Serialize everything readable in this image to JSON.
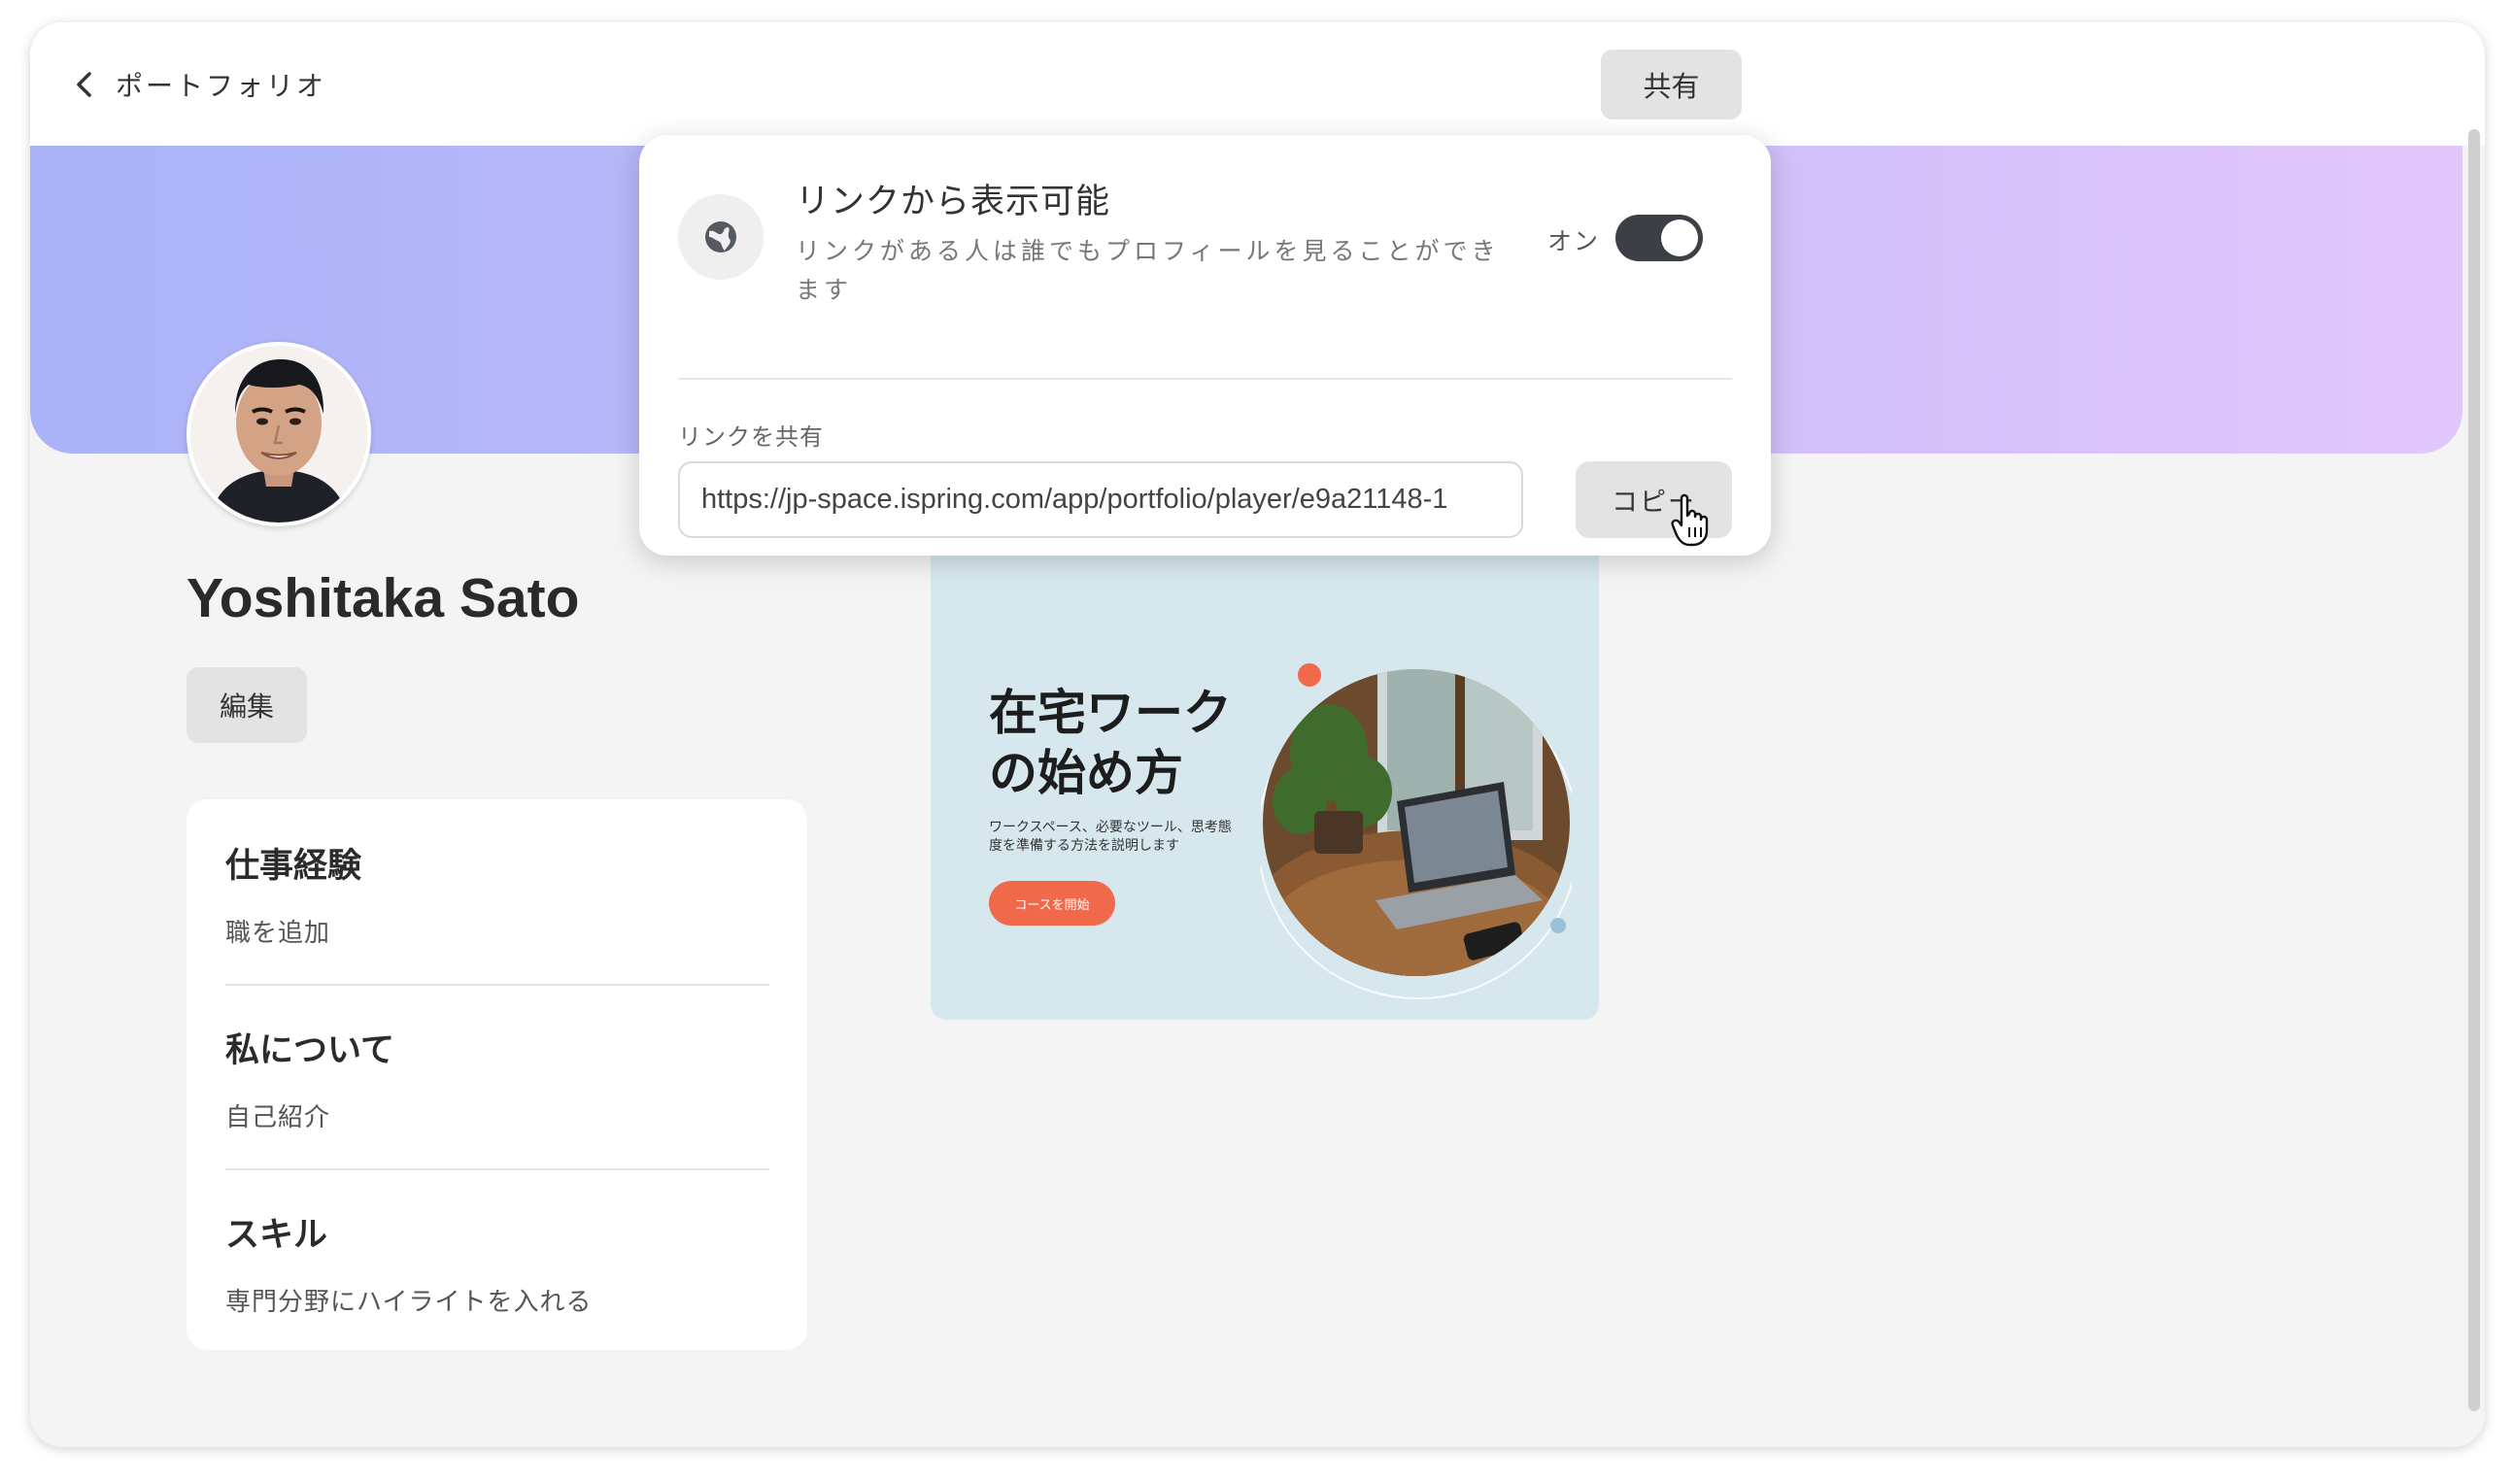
{
  "header": {
    "title": "ポートフォリオ",
    "share_label": "共有"
  },
  "profile": {
    "name": "Yoshitaka Sato",
    "edit_label": "編集"
  },
  "info_sections": [
    {
      "heading": "仕事経験",
      "subtext": "職を追加"
    },
    {
      "heading": "私について",
      "subtext": "自己紹介"
    },
    {
      "heading": "スキル",
      "subtext": "専門分野にハイライトを入れる"
    }
  ],
  "course": {
    "title": "在宅ワークの始め方",
    "description": "ワークスペース、必要なツール、思考態度を準備する方法を説明します",
    "button_label": "コースを開始"
  },
  "share_popup": {
    "title": "リンクから表示可能",
    "description": "リンクがある人は誰でもプロフィールを見ることができます",
    "toggle_label": "オン",
    "toggle_on": true,
    "link_label": "リンクを共有",
    "link_value": "https://jp-space.ispring.com/app/portfolio/player/e9a21148-1",
    "copy_label": "コピー"
  },
  "colors": {
    "cover_start": "#aab3f8",
    "cover_end": "#e2c7fb",
    "course_bg": "#d6e8ee",
    "course_button": "#f0694a",
    "toggle_on": "#3c3f45"
  },
  "icons": {
    "back": "chevron-left-icon",
    "globe": "globe-icon",
    "cursor": "hand-cursor-icon"
  }
}
